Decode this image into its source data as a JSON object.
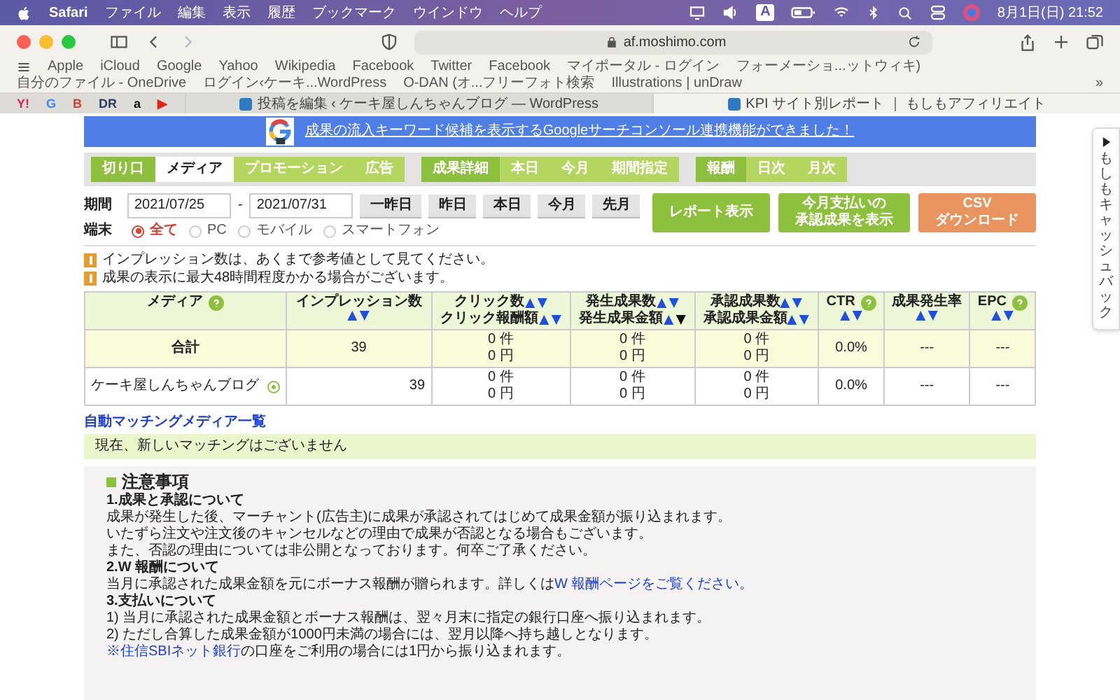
{
  "menubar": {
    "app": "Safari",
    "items": [
      "ファイル",
      "編集",
      "表示",
      "履歴",
      "ブックマーク",
      "ウインドウ",
      "ヘルプ"
    ],
    "input_source": "A",
    "clock": "8月1日(日) 21:52"
  },
  "browser": {
    "url": "af.moshimo.com",
    "back_enabled": true,
    "forward_enabled": false
  },
  "bookmarks": [
    "Apple",
    "iCloud",
    "Google",
    "Yahoo",
    "Wikipedia",
    "Facebook",
    "Twitter",
    "Facebook",
    "マイポータル - ログイン",
    "フォーメーショ...ットウィキ)",
    "自分のファイル - OneDrive",
    "ログイン‹ケーキ...WordPress",
    "O-DAN (オ...フリーフォト検索",
    "Illustrations | unDraw"
  ],
  "bookmarks_more": "»",
  "pinned_tabs": [
    {
      "glyph": "Y!",
      "color": "#e0245e"
    },
    {
      "glyph": "G",
      "color": "#4285f4"
    },
    {
      "glyph": "B",
      "color": "#d23f31"
    },
    {
      "glyph": "DR",
      "color": "#2d3e63"
    },
    {
      "glyph": "a",
      "color": "#111111"
    },
    {
      "glyph": "▶",
      "color": "#e62117"
    }
  ],
  "tabs": [
    {
      "title": "投稿を編集 ‹ ケーキ屋しんちゃんブログ — WordPress",
      "selected": false
    },
    {
      "title": "KPI サイト別レポート ｜ もしもアフィリエイト",
      "selected": true
    }
  ],
  "banner": {
    "text": "成果の流入キーワード候補を表示するGoogleサーチコンソール連携機能ができました！"
  },
  "tab_groups": [
    {
      "label": "切り口",
      "items": [
        {
          "label": "メディア",
          "selected": true
        },
        {
          "label": "プロモーション",
          "selected": false
        },
        {
          "label": "広告",
          "selected": false
        }
      ]
    },
    {
      "label": "成果詳細",
      "items": [
        {
          "label": "本日",
          "selected": false
        },
        {
          "label": "今月",
          "selected": false
        },
        {
          "label": "期間指定",
          "selected": false
        }
      ]
    },
    {
      "label": "報酬",
      "items": [
        {
          "label": "日次",
          "selected": false
        },
        {
          "label": "月次",
          "selected": false
        }
      ]
    }
  ],
  "period": {
    "label": "期間",
    "from": "2021/07/25",
    "separator": "-",
    "to": "2021/07/31",
    "quick": [
      "一昨日",
      "昨日",
      "本日",
      "今月",
      "先月"
    ]
  },
  "device": {
    "label": "端末",
    "options": [
      {
        "label": "全て",
        "selected": true
      },
      {
        "label": "PC",
        "selected": false
      },
      {
        "label": "モバイル",
        "selected": false
      },
      {
        "label": "スマートフォン",
        "selected": false
      }
    ]
  },
  "actions": [
    {
      "lines": [
        "レポート表示"
      ],
      "color": "#8dc03c"
    },
    {
      "lines": [
        "今月支払いの",
        "承認成果を表示"
      ],
      "color": "#8dc03c"
    },
    {
      "lines": [
        "CSV",
        "ダウンロード"
      ],
      "color": "#e9935e"
    }
  ],
  "notices": [
    "インプレッション数は、あくまで参考値として見てください。",
    "成果の表示に最大48時間程度かかる場合がございます。"
  ],
  "table": {
    "columns": [
      {
        "lines": [
          {
            "text": "メディア"
          }
        ],
        "help": true
      },
      {
        "lines": [
          {
            "text": "インプレッション数"
          },
          {
            "sortable": true,
            "sorted_desc": false
          }
        ],
        "help": false
      },
      {
        "lines": [
          {
            "text": "クリック数",
            "sortable": true,
            "sorted_desc": false
          },
          {
            "text": "クリック報酬額",
            "sortable": true,
            "sorted_desc": false
          }
        ],
        "help": false
      },
      {
        "lines": [
          {
            "text": "発生成果数",
            "sortable": true,
            "sorted_desc": false
          },
          {
            "text": "発生成果金額",
            "sortable": true,
            "sorted_desc": true
          }
        ],
        "help": false
      },
      {
        "lines": [
          {
            "text": "承認成果数",
            "sortable": true,
            "sorted_desc": false
          },
          {
            "text": "承認成果金額",
            "sortable": true,
            "sorted_desc": false
          }
        ],
        "help": false
      },
      {
        "lines": [
          {
            "text": "CTR"
          },
          {
            "sortable": true,
            "sorted_desc": false
          }
        ],
        "help": true
      },
      {
        "lines": [
          {
            "text": "成果発生率"
          },
          {
            "sortable": true,
            "sorted_desc": false
          }
        ],
        "help": false
      },
      {
        "lines": [
          {
            "text": "EPC"
          },
          {
            "sortable": true,
            "sorted_desc": false
          }
        ],
        "help": true
      }
    ],
    "rows": [
      {
        "kind": "total",
        "cells": [
          [
            "合計"
          ],
          [
            "39"
          ],
          [
            "0 件",
            "0 円"
          ],
          [
            "0 件",
            "0 円"
          ],
          [
            "0 件",
            "0 円"
          ],
          [
            "0.0%"
          ],
          [
            "---"
          ],
          [
            "---"
          ]
        ]
      },
      {
        "kind": "item",
        "cells": [
          [
            "ケーキ屋しんちゃんブログ"
          ],
          [
            "39"
          ],
          [
            "0 件",
            "0 円"
          ],
          [
            "0 件",
            "0 円"
          ],
          [
            "0 件",
            "0 円"
          ],
          [
            "0.0%"
          ],
          [
            "---"
          ],
          [
            "---"
          ]
        ]
      }
    ]
  },
  "matching": {
    "link": "自動マッチングメディア一覧",
    "message": "現在、新しいマッチングはございません"
  },
  "notes": {
    "title": "注意事項",
    "lines": [
      {
        "kind": "heading",
        "parts": [
          {
            "text": "1.成果と承認について",
            "link": false
          }
        ]
      },
      {
        "kind": "text",
        "parts": [
          {
            "text": "成果が発生した後、マーチャント(広告主)に成果が承認されてはじめて成果金額が振り込まれます。",
            "link": false
          }
        ]
      },
      {
        "kind": "text",
        "parts": [
          {
            "text": "いたずら注文や注文後のキャンセルなどの理由で成果が否認となる場合もございます。",
            "link": false
          }
        ]
      },
      {
        "kind": "text",
        "parts": [
          {
            "text": "また、否認の理由については非公開となっております。何卒ご了承ください。",
            "link": false
          }
        ]
      },
      {
        "kind": "heading",
        "parts": [
          {
            "text": "2.W 報酬について",
            "link": false
          }
        ]
      },
      {
        "kind": "text",
        "parts": [
          {
            "text": "当月に承認された成果金額を元にボーナス報酬が贈られます。詳しくは",
            "link": false
          },
          {
            "text": "W 報酬ページをご覧ください",
            "link": true
          },
          {
            "text": "。",
            "link": false
          }
        ]
      },
      {
        "kind": "heading",
        "parts": [
          {
            "text": "3.支払いについて",
            "link": false
          }
        ]
      },
      {
        "kind": "text",
        "parts": [
          {
            "text": "1) 当月に承認された成果金額とボーナス報酬は、翌々月末に指定の銀行口座へ振り込まれます。",
            "link": false
          }
        ]
      },
      {
        "kind": "text",
        "parts": [
          {
            "text": "2) ただし合算した成果金額が1000円未満の場合には、翌月以降へ持ち越しとなります。",
            "link": false
          }
        ]
      },
      {
        "kind": "text",
        "parts": [
          {
            "text": "※住信SBIネット銀行",
            "link": true
          },
          {
            "text": "の口座をご利用の場合には1円から振り込まれます。",
            "link": false
          }
        ]
      }
    ]
  },
  "side_tab": {
    "text": "もしもキャッシュバック"
  }
}
